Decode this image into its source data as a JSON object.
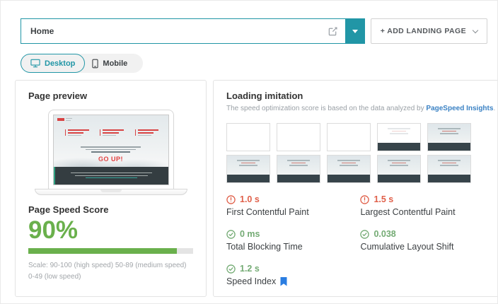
{
  "header": {
    "page_selector": {
      "value": "Home"
    },
    "add_button": {
      "label": "+ ADD LANDING PAGE"
    }
  },
  "device_toggle": {
    "desktop_label": "Desktop",
    "mobile_label": "Mobile"
  },
  "preview_card": {
    "title": "Page preview",
    "laptop_headline": "GO UP!",
    "score_title": "Page Speed Score",
    "score_value": "90%",
    "score_percent": 90,
    "scale_note": "Scale: 90-100 (high speed) 50-89 (medium speed) 0-49 (low speed)"
  },
  "loading_card": {
    "title": "Loading imitation",
    "subtitle_prefix": "The speed optimization score is based on the data analyzed by ",
    "subtitle_link": "PageSpeed Insights",
    "subtitle_suffix": ".",
    "thumbnails": [
      "blank",
      "blank",
      "blank",
      "partial",
      "loaded",
      "loaded",
      "loaded",
      "loaded",
      "loaded",
      "loaded"
    ],
    "metrics": [
      {
        "value": "1.0 s",
        "label": "First Contentful Paint",
        "status": "warning",
        "bookmark": false
      },
      {
        "value": "1.5 s",
        "label": "Largest Contentful Paint",
        "status": "warning",
        "bookmark": false
      },
      {
        "value": "0 ms",
        "label": "Total Blocking Time",
        "status": "good",
        "bookmark": false
      },
      {
        "value": "0.038",
        "label": "Cumulative Layout Shift",
        "status": "good",
        "bookmark": false
      },
      {
        "value": "1.2 s",
        "label": "Speed Index",
        "status": "good",
        "bookmark": true
      }
    ]
  },
  "colors": {
    "accent_teal": "#2196a6",
    "score_green": "#6ab04c",
    "warning_red": "#e0604a",
    "good_green": "#74ab74",
    "link_blue": "#3b82c4",
    "bookmark_blue": "#2a7de1"
  }
}
